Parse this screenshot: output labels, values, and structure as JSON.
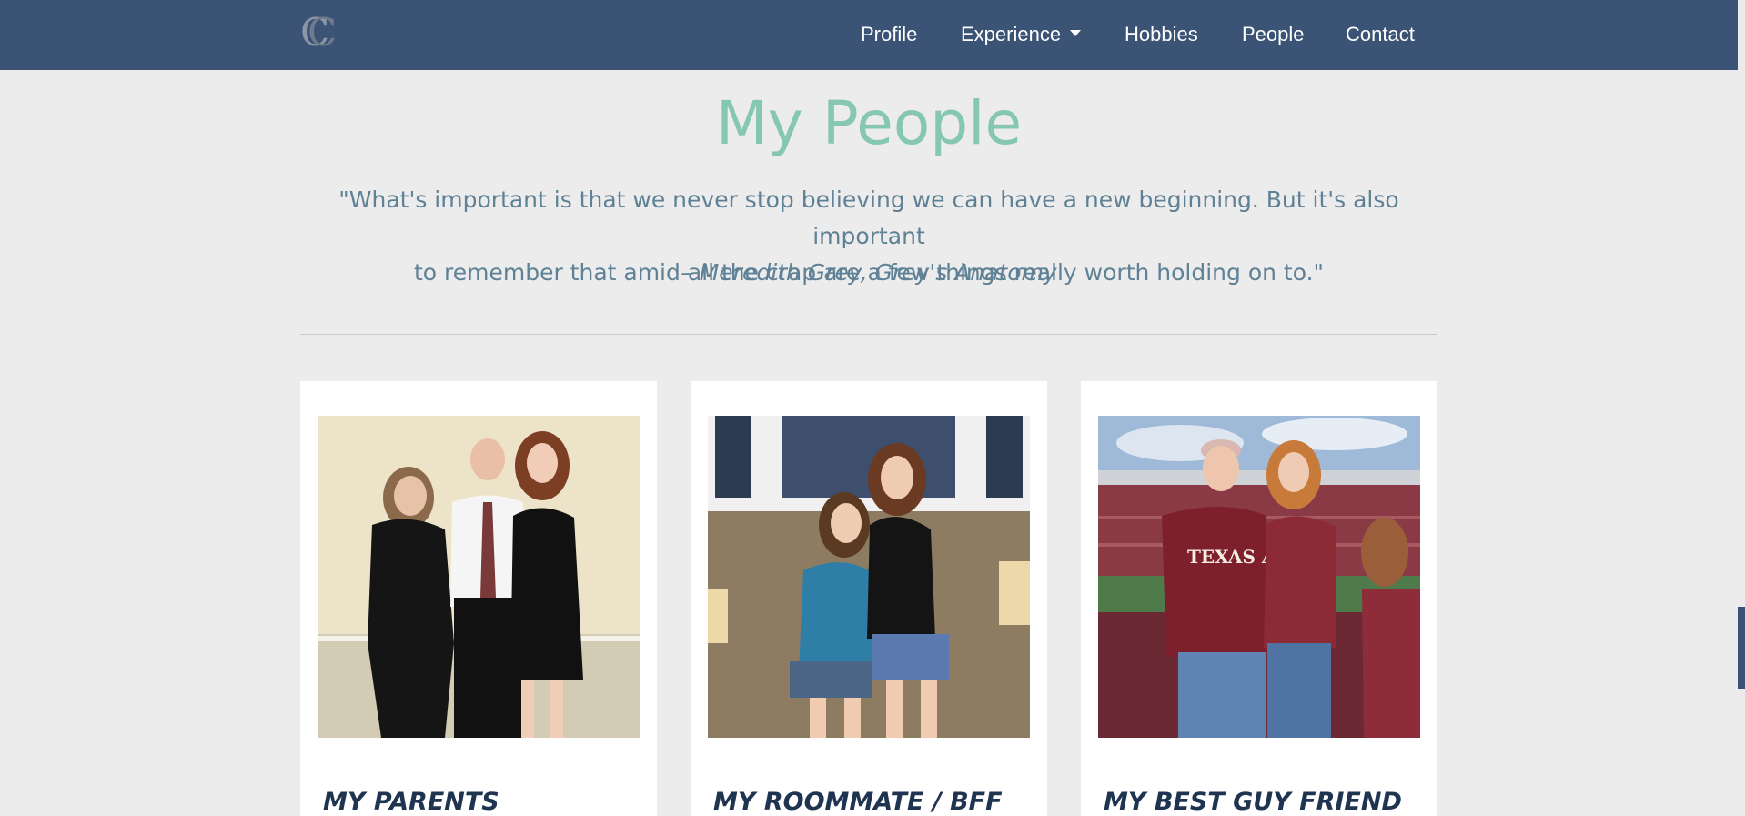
{
  "nav": {
    "brand_mark": "C",
    "items": [
      {
        "label": "Profile"
      },
      {
        "label": "Experience",
        "has_dropdown": true
      },
      {
        "label": "Hobbies"
      },
      {
        "label": "People"
      },
      {
        "label": "Contact"
      }
    ]
  },
  "header": {
    "title": "My People",
    "quote_line1": "\"What's important is that we never stop believing we can have a new beginning. But it's also important",
    "quote_line2": "to remember that amid all the crap are a few things really worth holding on to.\"",
    "attribution": "– Meredith Grey, Grey's Anatomy"
  },
  "cards": [
    {
      "title": "MY PARENTS",
      "photo_icon": "family-photo"
    },
    {
      "title": "MY ROOMMATE / BFF",
      "photo_icon": "friends-photo"
    },
    {
      "title": "MY BEST GUY FRIEND",
      "photo_icon": "stadium-photo"
    }
  ],
  "colors": {
    "navbar": "#3b5374",
    "accent": "#86c7b4",
    "quote": "#5f8195",
    "card_title": "#1f3450",
    "background": "#ececec"
  }
}
